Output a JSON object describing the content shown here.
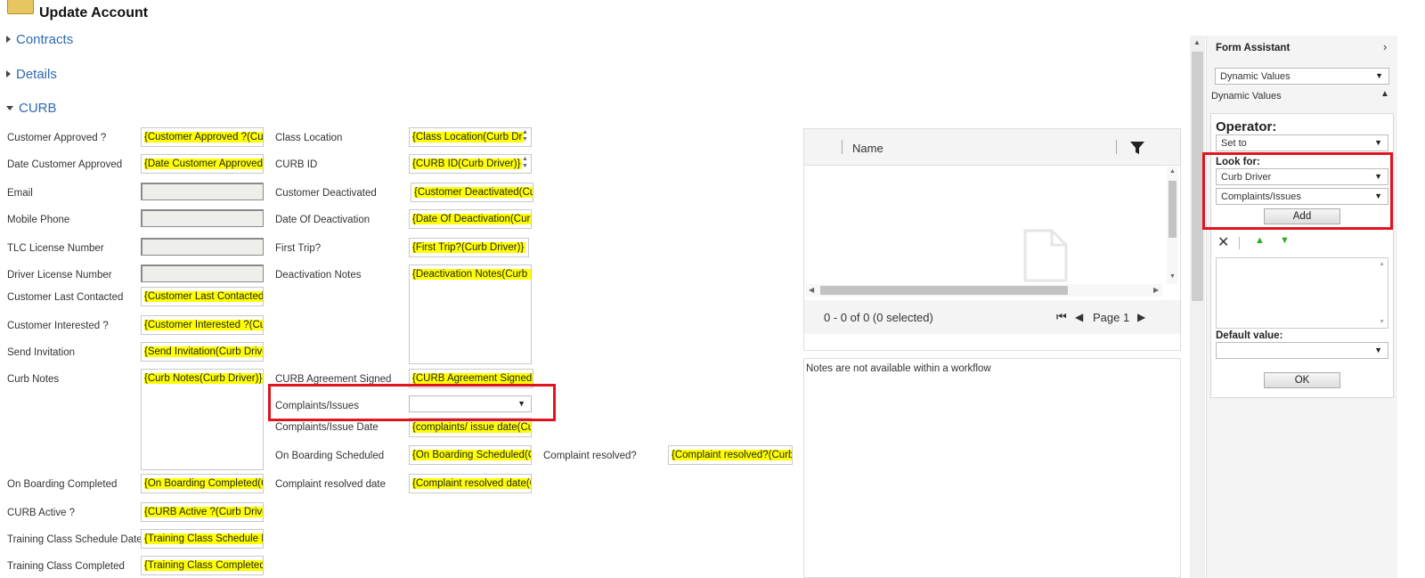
{
  "header": {
    "title": "Update Account"
  },
  "sections": {
    "contracts": "Contracts",
    "details": "Details",
    "curb": "CURB"
  },
  "form": {
    "col1": [
      {
        "label": "Customer Approved ?",
        "value": "{Customer Approved ?(Curb"
      },
      {
        "label": "Date Customer Approved",
        "value": "{Date Customer Approved("
      },
      {
        "label": "Email",
        "value": ""
      },
      {
        "label": "Mobile Phone",
        "value": ""
      },
      {
        "label": "TLC License Number",
        "value": ""
      },
      {
        "label": "Driver License Number",
        "value": ""
      },
      {
        "label": "Customer Last Contacted",
        "value": "{Customer Last Contacted("
      },
      {
        "label": "Customer Interested ?",
        "value": "{Customer Interested ?(Curl"
      },
      {
        "label": "Send Invitation",
        "value": "{Send Invitation(Curb Drive"
      },
      {
        "label": "Curb Notes",
        "value": "{Curb Notes(Curb Driver)}"
      },
      {
        "label": "On Boarding Completed",
        "value": "{On Boarding Completed(C"
      },
      {
        "label": "CURB Active ?",
        "value": "{CURB Active ?(Curb Driver)"
      },
      {
        "label": "Training Class Schedule Date",
        "value": "{Training Class Schedule Da"
      },
      {
        "label": "Training Class Completed",
        "value": "{Training Class Completed("
      }
    ],
    "col2": [
      {
        "label": "Class Location",
        "value": "{Class Location(Curb Dr"
      },
      {
        "label": "CURB ID",
        "value": "{CURB ID(Curb Driver)}"
      },
      {
        "label": "Customer Deactivated",
        "value": "{Customer Deactivated(Cur"
      },
      {
        "label": "Date Of Deactivation",
        "value": "{Date Of Deactivation(Curb"
      },
      {
        "label": "First Trip?",
        "value": "{First Trip?(Curb Driver)}"
      },
      {
        "label": "Deactivation Notes",
        "value": "{Deactivation Notes(Curb D"
      },
      {
        "label": "CURB Agreement Signed",
        "value": "{CURB Agreement Signed(C"
      },
      {
        "label": "Complaints/Issues",
        "value": ""
      },
      {
        "label": "Complaints/Issue Date",
        "value": "{complaints/ issue date(Cu"
      },
      {
        "label": "On Boarding Scheduled",
        "value": "{On Boarding Scheduled(Cu"
      },
      {
        "label": "Complaint resolved date",
        "value": "{Complaint resolved date(C"
      }
    ],
    "col3": [
      {
        "label": "Complaint resolved?",
        "value": "{Complaint resolved?(Curb"
      }
    ]
  },
  "grid": {
    "column": "Name",
    "status": "0 - 0 of 0 (0 selected)",
    "page": "Page 1"
  },
  "notes": {
    "text": "Notes are not available within a workflow"
  },
  "assistant": {
    "title": "Form Assistant",
    "mode": "Dynamic Values",
    "section": "Dynamic Values",
    "operator_label": "Operator:",
    "operator_value": "Set to",
    "lookfor_label": "Look for:",
    "lookfor_entity": "Curb Driver",
    "lookfor_field": "Complaints/Issues",
    "add_label": "Add",
    "default_label": "Default value:",
    "default_value": "",
    "ok_label": "OK"
  }
}
